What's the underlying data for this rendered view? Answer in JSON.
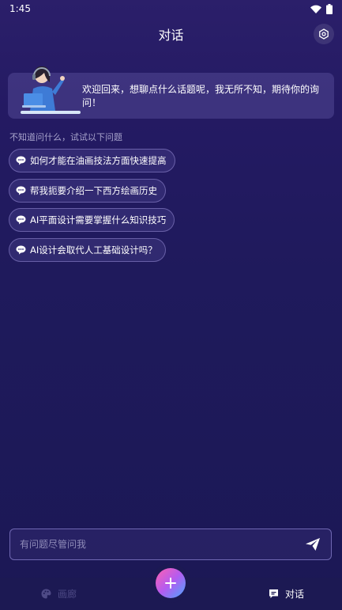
{
  "status_bar": {
    "time": "1:45"
  },
  "header": {
    "title": "对话"
  },
  "welcome": {
    "message": "欢迎回来，想聊点什么话题呢，我无所不知，期待你的询问！"
  },
  "suggestions": {
    "label": "不知道问什么，试试以下问题",
    "items": [
      {
        "text": "如何才能在油画技法方面快速提高"
      },
      {
        "text": "帮我扼要介绍一下西方绘画历史"
      },
      {
        "text": "AI平面设计需要掌握什么知识技巧"
      },
      {
        "text": "AI设计会取代人工基础设计吗？"
      }
    ]
  },
  "input": {
    "placeholder": "有问题尽管问我"
  },
  "bottom_nav": {
    "gallery_label": "画廊",
    "chat_label": "对话"
  },
  "colors": {
    "background": "#1f1a5c",
    "accent_pink": "#ff5fb0",
    "accent_blue": "#4aa7ff",
    "inactive": "#4e4a86"
  }
}
